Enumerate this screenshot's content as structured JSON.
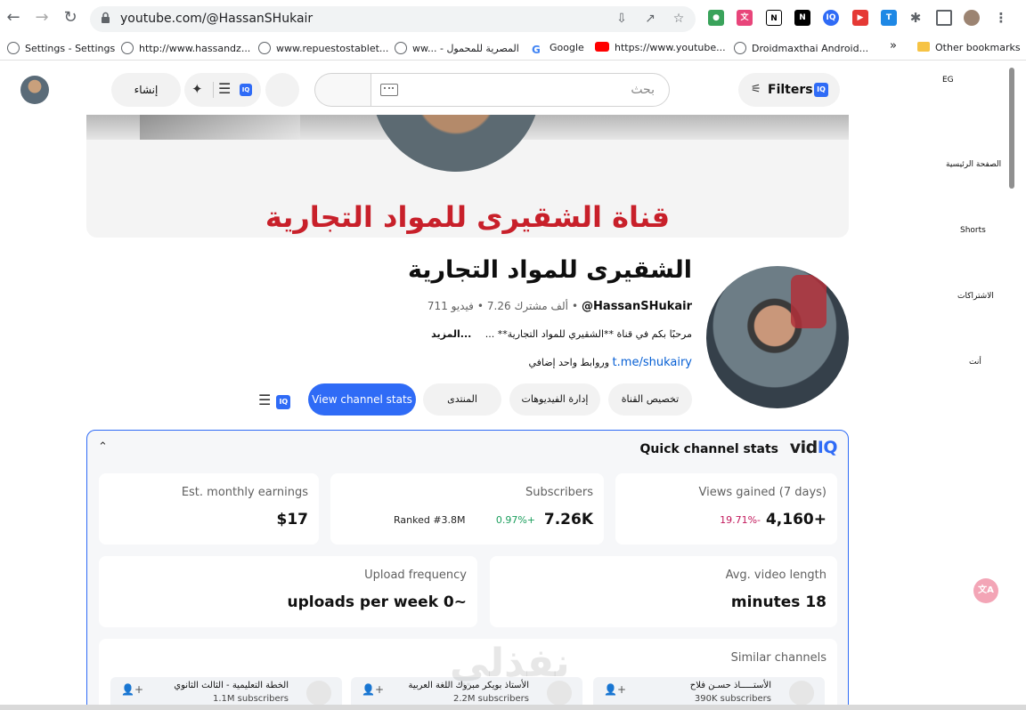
{
  "browser": {
    "url": "youtube.com/@HassanSHukair",
    "bookmarks": [
      {
        "label": "Settings - Settings",
        "icon": "gear"
      },
      {
        "label": "http://www.hassandz...",
        "icon": "globe"
      },
      {
        "label": "www.repuestostablet...",
        "icon": "globe"
      },
      {
        "label": "ww... - المصرية للمحمول",
        "icon": "globe"
      },
      {
        "label": "Google",
        "icon": "google"
      },
      {
        "label": "https://www.youtube...",
        "icon": "youtube"
      },
      {
        "label": "Droidmaxthai Android...",
        "icon": "globe"
      }
    ],
    "more_bookmarks": "»",
    "other_bookmarks": "Other bookmarks"
  },
  "header": {
    "create_label": "إنشاء",
    "search_placeholder": "بحث",
    "filters_label": "Filters",
    "iq_badge": "IQ",
    "region": "EG"
  },
  "sidebar": {
    "items": [
      {
        "label": "الصفحة الرئيسية"
      },
      {
        "label": "Shorts"
      },
      {
        "label": "الاشتراكات"
      },
      {
        "label": "أنت"
      }
    ]
  },
  "banner": {
    "text": "قناة الشقيرى للمواد التجارية"
  },
  "channel": {
    "name": "الشقيرى للمواد التجارية",
    "handle": "@HassanSHukair",
    "subscribers": "7.26 ألف مشترك",
    "videos": "711 فيديو",
    "separator": "•",
    "description": "مرحبًا بكم في قناة **الشقيري للمواد التجارية** ...",
    "more_label": "...المزيد",
    "link": "t.me/shukairy",
    "link_suffix": "وروابط واحد إضافي",
    "buttons": {
      "customize": "تخصيص القناة",
      "manage_videos": "إدارة الفيديوهات",
      "forum": "المنتدى",
      "view_stats": "View channel stats"
    }
  },
  "quick_stats": {
    "title": "Quick channel stats",
    "brand_vid": "vid",
    "brand_iq": "IQ",
    "cards": {
      "earnings": {
        "label": "Est. monthly earnings",
        "value": "$17"
      },
      "subscribers": {
        "label": "Subscribers",
        "value": "7.26K",
        "change": "0.97%+",
        "rank": "Ranked #3.8M"
      },
      "views": {
        "label": "Views gained (7 days)",
        "value": "4,160+",
        "change": "19.71%-"
      },
      "upload": {
        "label": "Upload frequency",
        "value": "uploads per week 0~"
      },
      "length": {
        "label": "Avg. video length",
        "value": "minutes 18"
      },
      "similar": {
        "label": "Similar channels"
      }
    },
    "similar_channels": [
      {
        "name": "الخطة التعليمية - الثالث الثانوي",
        "subs": "1.1M subscribers"
      },
      {
        "name": "الأستاذ بويكر مبروك اللغة العربية",
        "subs": "2.2M subscribers"
      },
      {
        "name": "الأستـــــاذ حسـن فلاح",
        "subs": "390K subscribers"
      }
    ]
  },
  "watermark": "نفذلي",
  "colors": {
    "accent": "#2f6bf6",
    "positive": "#1a9e5c",
    "negative": "#c2185b",
    "banner_text": "#c8202a"
  }
}
